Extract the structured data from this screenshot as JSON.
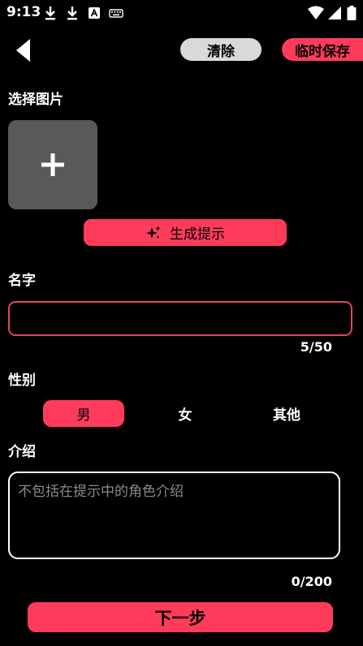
{
  "status_bar": {
    "time": "9:13",
    "left_icons": [
      "download-icon",
      "download-icon",
      "text-a-icon",
      "keyboard-icon"
    ],
    "right_icons": [
      "wifi-icon",
      "signal-icon",
      "battery-icon"
    ]
  },
  "header": {
    "back_icon": "back-arrow-icon",
    "clear_label": "清除",
    "temp_save_label": "临时保存"
  },
  "image_section": {
    "label": "选择图片",
    "add_icon": "plus-icon"
  },
  "generate_prompt": {
    "label": "生成提示",
    "icon": "sparkle-icon"
  },
  "name_section": {
    "label": "名字",
    "value": "",
    "counter": "5/50"
  },
  "gender_section": {
    "label": "性别",
    "options": [
      "男",
      "女",
      "其他"
    ],
    "selected": "男"
  },
  "intro_section": {
    "label": "介绍",
    "placeholder": "不包括在提示中的角色介绍",
    "value": "",
    "counter": "0/200"
  },
  "next_button": {
    "label": "下一步"
  },
  "colors": {
    "background": "#000000",
    "accent": "#ff3b5c",
    "input_border": "#e0455f",
    "clear_button": "#d9d9d9",
    "image_picker": "#595959"
  }
}
